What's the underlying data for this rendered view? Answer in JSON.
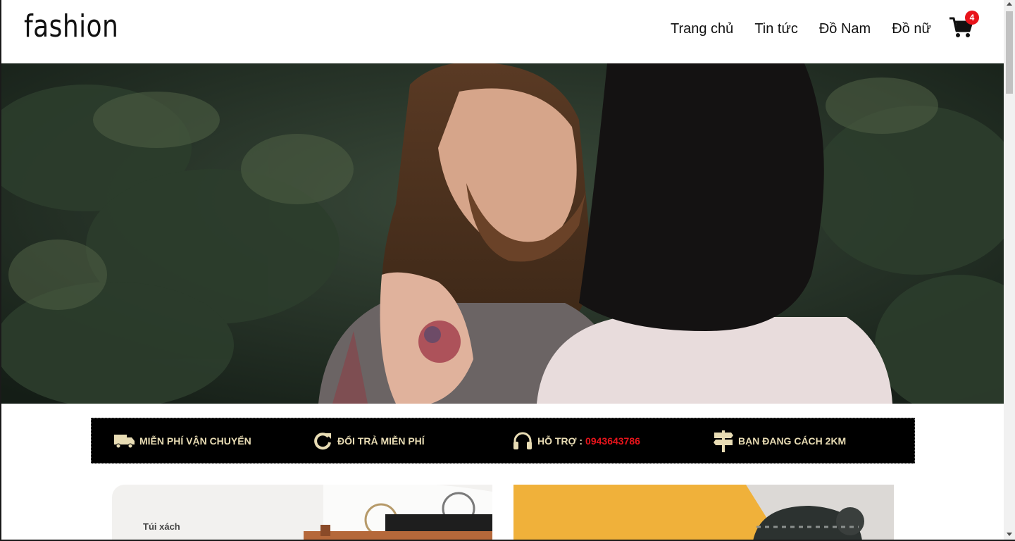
{
  "header": {
    "logo": "fashion",
    "nav": [
      "Trang chủ",
      "Tin tức",
      "Đồ Nam",
      "Đồ nữ"
    ],
    "cart_count": "4"
  },
  "hero": {
    "alt": "couple photo in forest"
  },
  "features": [
    {
      "icon": "truck-icon",
      "text": "MIỄN PHÍ VẬN CHUYỂN"
    },
    {
      "icon": "refresh-icon",
      "text": "ĐỔI TRẢ MIỄN PHÍ"
    },
    {
      "icon": "headphones-icon",
      "text": "HỖ TRỢ :",
      "phone": "0943643786"
    },
    {
      "icon": "signpost-icon",
      "text": "BẠN ĐANG CÁCH 2KM"
    }
  ],
  "banners": {
    "left_label": "Túi xách"
  },
  "colors": {
    "accent_red": "#e8141b",
    "feature_text": "#e8dcb4",
    "feature_bg": "#000000"
  }
}
